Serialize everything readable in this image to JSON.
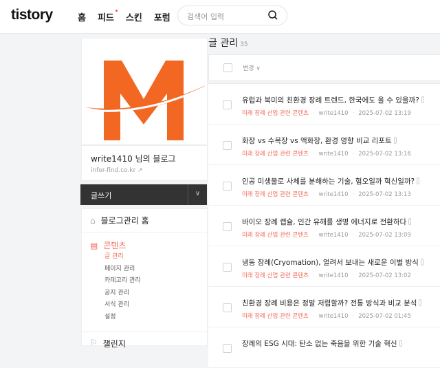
{
  "header": {
    "logo": "tistory",
    "nav": [
      "홈",
      "피드",
      "스킨",
      "포럼"
    ],
    "search_placeholder": "검색어 입력"
  },
  "blog": {
    "name": "write1410 님의 블로그",
    "url": "infor-find.co.kr",
    "brand_color": "#f26722"
  },
  "write_button": "글쓰기",
  "menu": {
    "home": "블로그관리 홈",
    "contents": {
      "title": "콘텐츠",
      "items": [
        "글 관리",
        "페이지 관리",
        "카테고리 관리",
        "공지 관리",
        "서식 관리",
        "설정"
      ]
    },
    "next": "챌린지"
  },
  "page": {
    "title": "글 관리",
    "count": "35",
    "change_label": "변경"
  },
  "posts": [
    {
      "title": "유럽과 북미의 친환경 장례 트렌드, 한국에도 올 수 있을까?",
      "category": "미래 장례 산업 관련 콘텐츠",
      "author": "write1410",
      "date": "2025-07-02 13:19"
    },
    {
      "title": "화장 vs 수목장 vs 액화장, 환경 영향 비교 리포트",
      "category": "미래 장례 산업 관련 콘텐츠",
      "author": "write1410",
      "date": "2025-07-02 13:16"
    },
    {
      "title": "인공 미생물로 사체를 분해하는 기술, 혐오일까 혁신일까?",
      "category": "미래 장례 산업 관련 콘텐츠",
      "author": "write1410",
      "date": "2025-07-02 13:13"
    },
    {
      "title": "바이오 장례 캡슐, 인간 유해를 생명 에너지로 전환하다",
      "category": "미래 장례 산업 관련 콘텐츠",
      "author": "write1410",
      "date": "2025-07-02 13:09"
    },
    {
      "title": "냉동 장례(Cryomation), 얼려서 보내는 새로운 이별 방식",
      "category": "미래 장례 산업 관련 콘텐츠",
      "author": "write1410",
      "date": "2025-07-02 13:02"
    },
    {
      "title": "친환경 장례 비용은 정말 저렴할까? 전통 방식과 비교 분석",
      "category": "미래 장례 산업 관련 콘텐츠",
      "author": "write1410",
      "date": "2025-07-02 01:45"
    },
    {
      "title": "장례의 ESG 시대: 탄소 없는 죽음을 위한 기술 혁신",
      "category": "",
      "author": "",
      "date": ""
    }
  ]
}
